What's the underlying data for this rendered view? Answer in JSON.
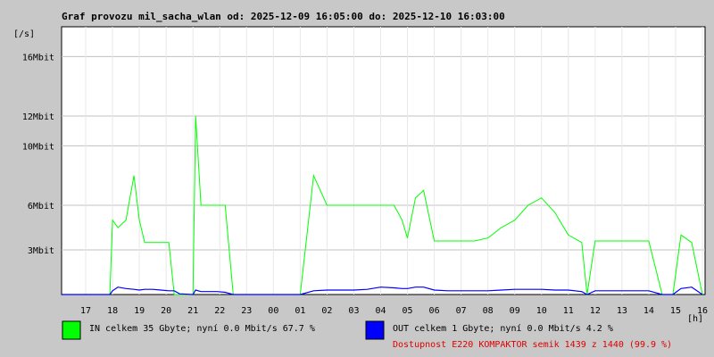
{
  "title": "Graf provozu mil_sacha_wlan od: 2025-12-09 16:05:00 do: 2025-12-10 16:03:00",
  "colors": {
    "background": "#c8c8c8",
    "plot_bg": "#ffffff",
    "grid": "#c0c0c0",
    "in": "#00ff00",
    "out": "#0000ff",
    "availability": "#e00000"
  },
  "legend": {
    "in_text": "IN celkem 35 Gbyte; nyní   0.0 Mbit/s 67.7 %",
    "out_text": "OUT celkem 1 Gbyte; nyní   0.0 Mbit/s 4.2 %",
    "availability_text": "Dostupnost E220 KOMPAKTOR semik 1439 z 1440 (99.9 %)"
  },
  "chart_data": {
    "type": "area",
    "title": "Graf provozu mil_sacha_wlan od: 2025-12-09 16:05:00 do: 2025-12-10 16:03:00",
    "ylabel": "[/s]",
    "xlabel": "[h]",
    "x_ticks": [
      "17",
      "18",
      "19",
      "20",
      "21",
      "22",
      "23",
      "00",
      "01",
      "02",
      "03",
      "04",
      "05",
      "06",
      "07",
      "08",
      "09",
      "10",
      "11",
      "12",
      "13",
      "14",
      "15",
      "16"
    ],
    "y_ticks": [
      {
        "label": "3Mbit",
        "value": 3
      },
      {
        "label": "6Mbit",
        "value": 6
      },
      {
        "label": "10Mbit",
        "value": 10
      },
      {
        "label": "12Mbit",
        "value": 12
      },
      {
        "label": "16Mbit",
        "value": 16
      }
    ],
    "ylim": [
      0,
      18
    ],
    "x_hours": [
      16.1,
      17.0,
      17.9,
      18.0,
      18.2,
      18.5,
      18.8,
      19.0,
      19.2,
      19.5,
      19.8,
      20.1,
      20.3,
      20.5,
      21.0,
      21.1,
      21.3,
      21.6,
      21.9,
      22.2,
      22.5,
      22.8,
      23.0,
      23.5,
      24.0,
      24.5,
      25.0,
      25.5,
      26.0,
      26.5,
      27.0,
      27.5,
      28.0,
      28.5,
      28.8,
      29.0,
      29.3,
      29.6,
      30.0,
      30.5,
      31.0,
      31.5,
      32.0,
      32.5,
      33.0,
      33.5,
      34.0,
      34.5,
      35.0,
      35.5,
      35.7,
      36.0,
      36.5,
      37.0,
      37.5,
      38.0,
      38.5,
      38.9,
      39.2,
      39.6,
      40.0
    ],
    "series": [
      {
        "name": "IN",
        "values": [
          0,
          0,
          0,
          5,
          4.5,
          5,
          8,
          5,
          3.5,
          3.5,
          3.5,
          3.5,
          0,
          0,
          0,
          12,
          6,
          6,
          6,
          6,
          0,
          0,
          0,
          0,
          0,
          0,
          0,
          8,
          6,
          6,
          6,
          6,
          6,
          6,
          5,
          3.8,
          6.5,
          7,
          3.6,
          3.6,
          3.6,
          3.6,
          3.8,
          4.5,
          5,
          6,
          6.5,
          5.5,
          4,
          3.5,
          0,
          3.6,
          3.6,
          3.6,
          3.6,
          3.6,
          0,
          0,
          4,
          3.5,
          0
        ]
      },
      {
        "name": "OUT",
        "values": [
          0,
          0,
          0,
          0.25,
          0.5,
          0.4,
          0.35,
          0.3,
          0.35,
          0.35,
          0.3,
          0.25,
          0.25,
          0.05,
          0,
          0.3,
          0.2,
          0.2,
          0.2,
          0.15,
          0,
          0,
          0,
          0,
          0,
          0,
          0,
          0.25,
          0.3,
          0.3,
          0.3,
          0.35,
          0.5,
          0.45,
          0.4,
          0.4,
          0.5,
          0.5,
          0.3,
          0.25,
          0.25,
          0.25,
          0.25,
          0.3,
          0.35,
          0.35,
          0.35,
          0.3,
          0.3,
          0.2,
          0,
          0.25,
          0.25,
          0.25,
          0.25,
          0.25,
          0,
          0,
          0.4,
          0.5,
          0
        ]
      }
    ],
    "xlim_hours": [
      16.1,
      40.1
    ],
    "grid": true
  }
}
